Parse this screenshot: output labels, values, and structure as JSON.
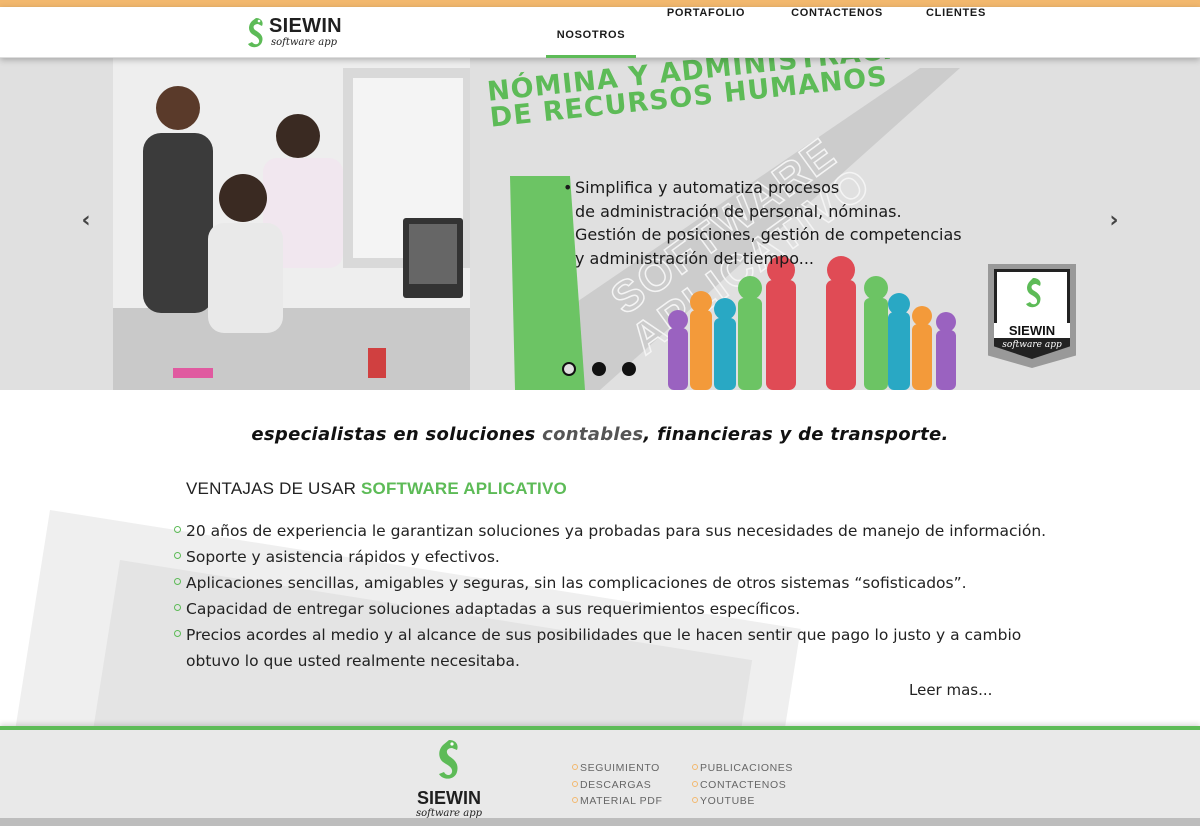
{
  "header": {
    "brand": "SIEWIN",
    "brand_tagline": "software app",
    "nav": [
      {
        "label": "NOSOTROS",
        "active": true
      },
      {
        "label": "PORTAFOLIO",
        "active": false
      },
      {
        "label": "CONTACTENOS",
        "active": false
      },
      {
        "label": "CLIENTES",
        "active": false
      }
    ]
  },
  "hero": {
    "title_line1": "NÓMINA Y ADMINISTRACIÓN",
    "title_line2": "DE RECURSOS HUMANOS",
    "bullet": "•",
    "body_lines": [
      "Simplifica y automatiza procesos",
      "de administración de personal, nóminas.",
      "Gestión de posiciones, gestión de competencias",
      "y administración del tiempo..."
    ],
    "watermark_lines": [
      "SOFTWARE",
      "APLICATIVO"
    ],
    "badge_brand": "SIEWIN",
    "badge_tagline": "software app",
    "prev_icon": "‹",
    "next_icon": "›",
    "slides_count": 3,
    "active_slide": 1
  },
  "main": {
    "tagline_pre": "especialistas en soluciones ",
    "tagline_hl": "contables",
    "tagline_post": ", financieras y de transporte.",
    "adv_title_pre": "VENTAJAS DE USAR ",
    "adv_title_hl": "SOFTWARE APLICATIVO",
    "advantages": [
      "20 años de experiencia le garantizan soluciones ya probadas para sus necesidades de manejo de información.",
      "Soporte y asistencia rápidos y efectivos.",
      "Aplicaciones sencillas, amigables y seguras, sin las complicaciones de otros sistemas “sofisticados”.",
      "Capacidad de entregar soluciones adaptadas  a sus requerimientos específicos.",
      "Precios acordes al medio y al alcance de sus posibilidades que le hacen sentir que pago lo justo y a cambio obtuvo lo que usted realmente necesitaba."
    ],
    "more_link": "Leer mas..."
  },
  "footer": {
    "brand": "SIEWIN",
    "brand_tagline": "software app",
    "col1": [
      "SEGUIMIENTO",
      "DESCARGAS",
      "MATERIAL PDF"
    ],
    "col2": [
      "PUBLICACIONES",
      "CONTACTENOS",
      "YOUTUBE"
    ]
  },
  "colors": {
    "accent_green": "#5dbb57",
    "top_bar": "#f2b86e"
  }
}
